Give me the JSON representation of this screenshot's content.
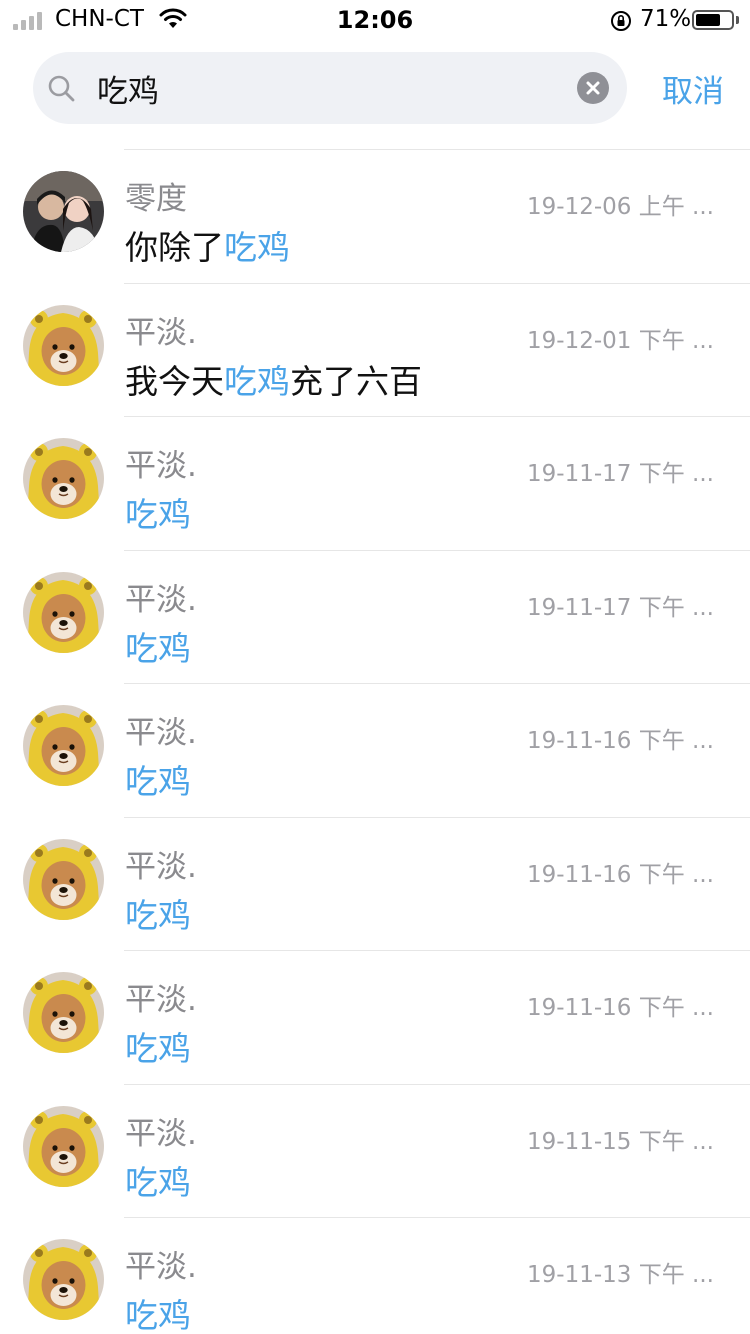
{
  "status_bar": {
    "carrier": "CHN-CT",
    "time": "12:06",
    "battery_percent": "71%",
    "battery_level": 0.71
  },
  "search": {
    "query": "吃鸡",
    "cancel_label": "取消"
  },
  "results": [
    {
      "sender": "零度",
      "time": "19-12-06 上午 ...",
      "avatar": "couple-photo",
      "pre": "你除了",
      "match": "吃鸡",
      "post": ""
    },
    {
      "sender": "平淡.",
      "time": "19-12-01 下午 ...",
      "avatar": "dog-raincoat",
      "pre": "我今天",
      "match": "吃鸡",
      "post": "充了六百"
    },
    {
      "sender": "平淡.",
      "time": "19-11-17 下午 ...",
      "avatar": "dog-raincoat",
      "pre": "",
      "match": "吃鸡",
      "post": ""
    },
    {
      "sender": "平淡.",
      "time": "19-11-17 下午 ...",
      "avatar": "dog-raincoat",
      "pre": "",
      "match": "吃鸡",
      "post": ""
    },
    {
      "sender": "平淡.",
      "time": "19-11-16 下午 ...",
      "avatar": "dog-raincoat",
      "pre": "",
      "match": "吃鸡",
      "post": ""
    },
    {
      "sender": "平淡.",
      "time": "19-11-16 下午 ...",
      "avatar": "dog-raincoat",
      "pre": "",
      "match": "吃鸡",
      "post": ""
    },
    {
      "sender": "平淡.",
      "time": "19-11-16 下午 ...",
      "avatar": "dog-raincoat",
      "pre": "",
      "match": "吃鸡",
      "post": ""
    },
    {
      "sender": "平淡.",
      "time": "19-11-15 下午 ...",
      "avatar": "dog-raincoat",
      "pre": "",
      "match": "吃鸡",
      "post": ""
    },
    {
      "sender": "平淡.",
      "time": "19-11-13 下午 ...",
      "avatar": "dog-raincoat",
      "pre": "",
      "match": "吃鸡",
      "post": ""
    }
  ],
  "colors": {
    "highlight": "#4aa3e8",
    "search_bg": "#eff1f5",
    "secondary_text": "#8a8a8e"
  }
}
